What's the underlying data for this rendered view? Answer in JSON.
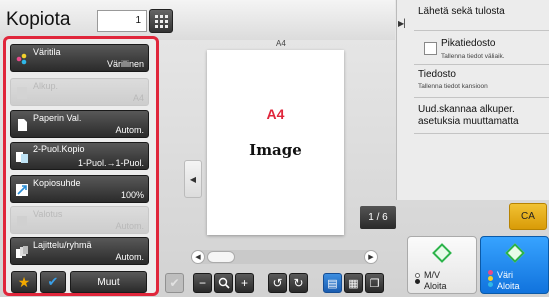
{
  "header": {
    "title": "Kopiota",
    "copies": "1",
    "keypad_icon": "keypad-icon"
  },
  "functions": [
    {
      "label": "Väritila",
      "value": "Värillinen",
      "enabled": true,
      "icon": "color-mode-icon"
    },
    {
      "label": "Alkup.",
      "value": "A4",
      "enabled": false,
      "icon": "original-icon"
    },
    {
      "label": "Paperin Val.",
      "value": "Autom.",
      "enabled": true,
      "icon": "paper-icon"
    },
    {
      "label": "2-Puol.Kopio",
      "value": "1-Puol.→1-Puol.",
      "enabled": true,
      "icon": "duplex-icon"
    },
    {
      "label": "Kopiosuhde",
      "value": "100%",
      "enabled": true,
      "icon": "ratio-icon"
    },
    {
      "label": "Valotus",
      "value": "Autom.",
      "enabled": false,
      "icon": "exposure-icon"
    },
    {
      "label": "Lajittelu/ryhmä",
      "value": "Autom.",
      "enabled": true,
      "icon": "sort-icon"
    }
  ],
  "bottom_left": {
    "star_icon": "star-icon",
    "check_icon": "check-icon",
    "more_label": "Muut"
  },
  "preview": {
    "paper_size": "A4",
    "doc_size_label": "A4",
    "doc_image_label": "Image",
    "page": "1 / 6"
  },
  "right_panel": {
    "send_print": "Lähetä sekä tulosta",
    "quick_file": "Pikatiedosto",
    "quick_file_sub": "Tallenna tiedot väliaik.",
    "file": "Tiedosto",
    "file_sub": "Tallenna tiedot kansioon",
    "rescan_line1": "Uud.skannaa alkuper.",
    "rescan_line2": "asetuksia muuttamatta"
  },
  "ca_label": "CA",
  "start": {
    "bw_line1": "M/V",
    "bw_line2": "Aloita",
    "color_line1": "Väri",
    "color_line2": "Aloita"
  },
  "colors": {
    "accent": "#e0263b",
    "start_color": "#1a7ae8",
    "ca": "#f0b41c",
    "start_diamond": "#2bb34a"
  }
}
